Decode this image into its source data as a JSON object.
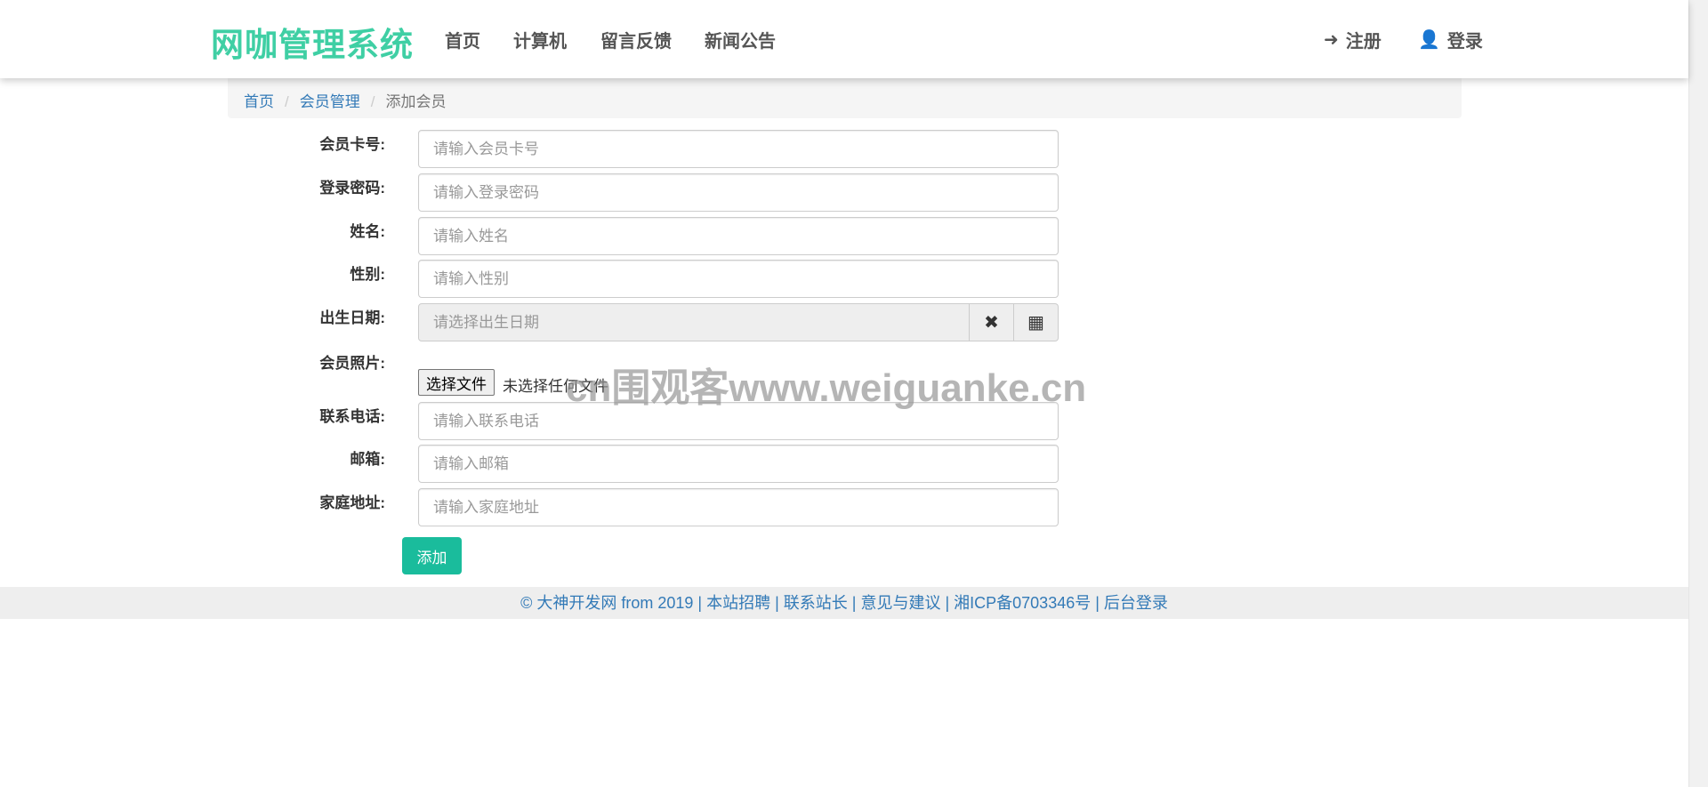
{
  "navbar": {
    "brand": "网咖管理系统",
    "items": [
      "首页",
      "计算机",
      "留言反馈",
      "新闻公告"
    ],
    "register": "注册",
    "login": "登录"
  },
  "breadcrumb": {
    "home": "首页",
    "section": "会员管理",
    "current": "添加会员"
  },
  "form": {
    "card": {
      "label": "会员卡号:",
      "placeholder": "请输入会员卡号"
    },
    "password": {
      "label": "登录密码:",
      "placeholder": "请输入登录密码"
    },
    "name": {
      "label": "姓名:",
      "placeholder": "请输入姓名"
    },
    "gender": {
      "label": "性别:",
      "placeholder": "请输入性别"
    },
    "birth": {
      "label": "出生日期:",
      "placeholder": "请选择出生日期"
    },
    "photo": {
      "label": "会员照片:",
      "button": "选择文件",
      "status": "未选择任何文件"
    },
    "phone": {
      "label": "联系电话:",
      "placeholder": "请输入联系电话"
    },
    "email": {
      "label": "邮箱:",
      "placeholder": "请输入邮箱"
    },
    "address": {
      "label": "家庭地址:",
      "placeholder": "请输入家庭地址"
    },
    "submit": "添加"
  },
  "footer": {
    "copyright": "© 大神开发网 from 2019",
    "links": [
      "本站招聘",
      "联系站长",
      "意见与建议",
      "湘ICP备0703346号",
      "后台登录"
    ],
    "sep": " | "
  },
  "watermark": "cn围观客www.weiguanke.cn",
  "colors": {
    "brand": "#3fcfa4",
    "button": "#1abc9c",
    "link": "#337ab7"
  }
}
